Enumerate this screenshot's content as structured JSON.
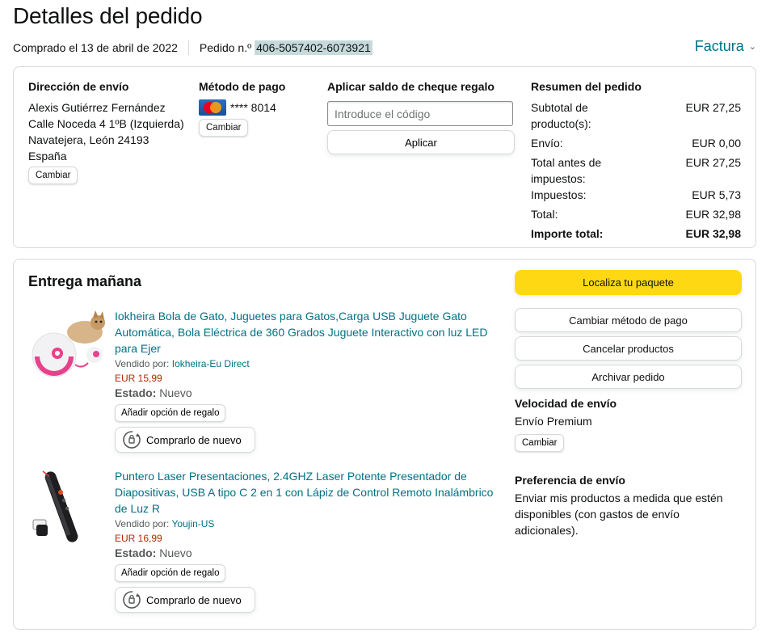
{
  "header": {
    "title": "Detalles del pedido",
    "purchased_on": "Comprado el 13 de abril de 2022",
    "order_label": "Pedido n.º",
    "order_number": "406-5057402-6073921",
    "invoice_label": "Factura"
  },
  "shipping": {
    "title": "Dirección de envío",
    "lines": [
      "Alexis Gutiérrez Fernández",
      "Calle Noceda 4 1ºB (Izquierda)",
      "Navatejera, León 24193",
      "España"
    ],
    "change_label": "Cambiar"
  },
  "payment": {
    "title": "Método de pago",
    "card_brand": "mastercard-icon",
    "card_masked": "**** 8014",
    "change_label": "Cambiar"
  },
  "gift_card": {
    "title": "Aplicar saldo de cheque regalo",
    "placeholder": "Introduce el código",
    "apply_label": "Aplicar"
  },
  "summary": {
    "title": "Resumen del pedido",
    "rows": [
      {
        "label": "Subtotal de producto(s):",
        "value": "EUR 27,25"
      },
      {
        "label": "Envío:",
        "value": "EUR 0,00"
      },
      {
        "label": "Total antes de impuestos:",
        "value": "EUR 27,25"
      },
      {
        "label": "Impuestos:",
        "value": "EUR 5,73"
      },
      {
        "label": "Total:",
        "value": "EUR 32,98"
      }
    ],
    "grand_total": {
      "label": "Importe total:",
      "value": "EUR 32,98"
    }
  },
  "delivery": {
    "title": "Entrega mañana",
    "items": [
      {
        "title": "Iokheira Bola de Gato, Juguetes para Gatos,Carga USB Juguete Gato Automática, Bola Eléctrica de 360 Grados Juguete Interactivo con luz LED para Ejer",
        "sold_by_label": "Vendido por:",
        "seller": "Iokheira-Eu Direct",
        "price": "EUR 15,99",
        "condition_label": "Estado:",
        "condition": "Nuevo",
        "gift_label": "Añadir opción de regalo",
        "buy_again_label": "Comprarlo de nuevo"
      },
      {
        "title": "Puntero Laser Presentaciones, 2.4GHZ Laser Potente Presentador de Diapositivas, USB A tipo C 2 en 1 con Lápiz de Control Remoto Inalámbrico de Luz R",
        "sold_by_label": "Vendido por:",
        "seller": "Youjin-US",
        "price": "EUR 16,99",
        "condition_label": "Estado:",
        "condition": "Nuevo",
        "gift_label": "Añadir opción de regalo",
        "buy_again_label": "Comprarlo de nuevo"
      }
    ]
  },
  "actions": {
    "track_label": "Localiza tu paquete",
    "change_payment_label": "Cambiar método de pago",
    "cancel_label": "Cancelar productos",
    "archive_label": "Archivar pedido",
    "speed_title": "Velocidad de envío",
    "speed_value": "Envío Premium",
    "speed_change_label": "Cambiar",
    "pref_title": "Preferencia de envío",
    "pref_value": "Enviar mis productos a medida que estén disponibles (con gastos de envío adicionales)."
  },
  "colors": {
    "link": "#007185",
    "price": "#b12704",
    "primary_button": "#ffd814",
    "order_highlight": "#c6dadb"
  }
}
